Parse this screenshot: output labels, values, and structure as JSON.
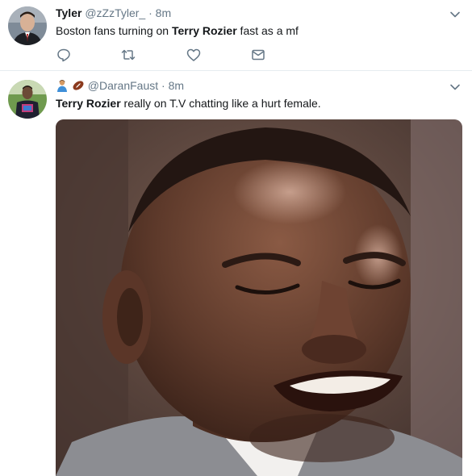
{
  "tweets": [
    {
      "name": "Tyler",
      "handle": "@zZzTyler_",
      "separator": "·",
      "time": "8m",
      "text_parts": [
        "Boston fans turning on ",
        "Terry Rozier",
        " fast as a mf"
      ],
      "actions": [
        "reply-icon",
        "retweet-icon",
        "like-icon",
        "dm-icon"
      ]
    },
    {
      "name_emojis": [
        "person-emoji",
        "football-emoji"
      ],
      "handle": "@DaranFaust",
      "separator": "·",
      "time": "8m",
      "text_parts": [
        "Terry Rozier",
        " really on T.V chatting like a hurt female."
      ],
      "media": {
        "kind": "image",
        "subject": "close-up-face-photo"
      }
    }
  ],
  "colors": {
    "text_primary": "#14171a",
    "text_secondary": "#657786",
    "icon": "#657786",
    "divider": "#e6ecf0"
  }
}
